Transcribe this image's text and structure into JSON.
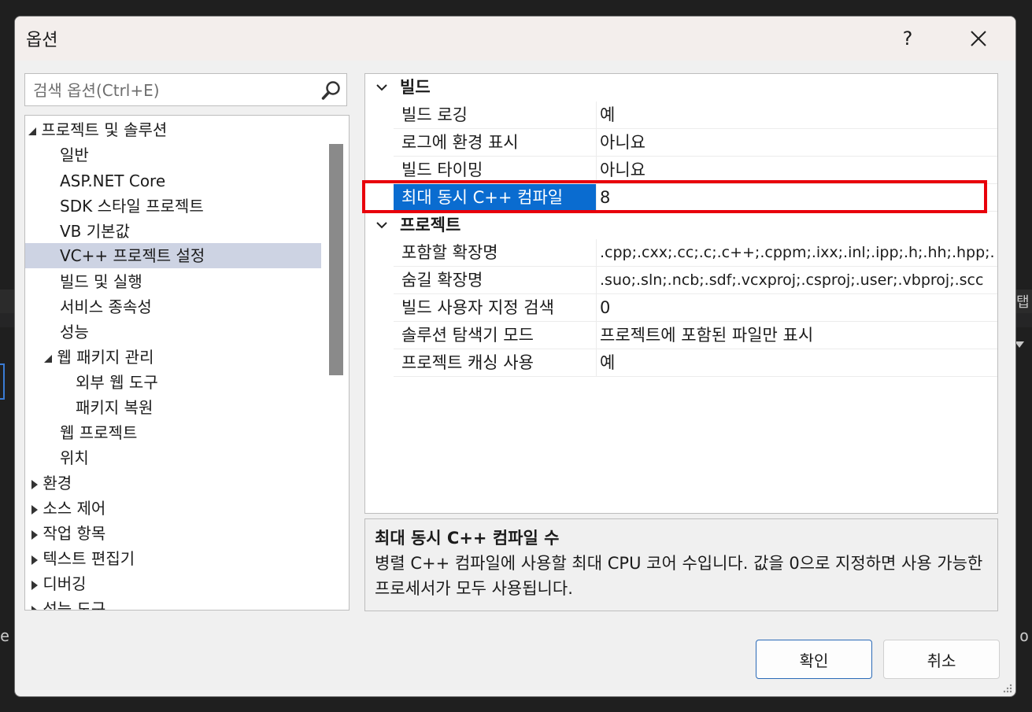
{
  "window": {
    "title": "옵션",
    "help_label": "?"
  },
  "search": {
    "placeholder": "검색 옵션(Ctrl+E)"
  },
  "tree": {
    "items": [
      {
        "label": "프로젝트 및 솔루션",
        "level": 0,
        "state": "expanded"
      },
      {
        "label": "일반",
        "level": 1
      },
      {
        "label": "ASP.NET Core",
        "level": 1
      },
      {
        "label": "SDK 스타일 프로젝트",
        "level": 1
      },
      {
        "label": "VB 기본값",
        "level": 1
      },
      {
        "label": "VC++ 프로젝트 설정",
        "level": 1,
        "selected": true
      },
      {
        "label": "빌드 및 실행",
        "level": 1
      },
      {
        "label": "서비스 종속성",
        "level": 1
      },
      {
        "label": "성능",
        "level": 1
      },
      {
        "label": "웹 패키지 관리",
        "level": 1,
        "state": "expanded"
      },
      {
        "label": "외부 웹 도구",
        "level": 2
      },
      {
        "label": "패키지 복원",
        "level": 2
      },
      {
        "label": "웹 프로젝트",
        "level": 1
      },
      {
        "label": "위치",
        "level": 1
      },
      {
        "label": "환경",
        "level": 0,
        "state": "collapsed"
      },
      {
        "label": "소스 제어",
        "level": 0,
        "state": "collapsed"
      },
      {
        "label": "작업 항목",
        "level": 0,
        "state": "collapsed"
      },
      {
        "label": "텍스트 편집기",
        "level": 0,
        "state": "collapsed"
      },
      {
        "label": "디버깅",
        "level": 0,
        "state": "collapsed"
      },
      {
        "label": "성능 도구",
        "level": 0,
        "state": "collapsed"
      }
    ]
  },
  "grid": {
    "categories": [
      {
        "label": "빌드",
        "rows": [
          {
            "name": "빌드 로깅",
            "value": "예"
          },
          {
            "name": "로그에 환경 표시",
            "value": "아니요"
          },
          {
            "name": "빌드 타이밍",
            "value": "아니요"
          },
          {
            "name": "최대 동시 C++ 컴파일",
            "value": "8",
            "selected": true
          }
        ]
      },
      {
        "label": "프로젝트",
        "rows": [
          {
            "name": "포함할 확장명",
            "value": ".cpp;.cxx;.cc;.c;.c++;.cppm;.ixx;.inl;.ipp;.h;.hh;.hpp;."
          },
          {
            "name": "숨길 확장명",
            "value": ".suo;.sln;.ncb;.sdf;.vcxproj;.csproj;.user;.vbproj;.scc"
          },
          {
            "name": "빌드 사용자 지정 검색",
            "value": "0"
          },
          {
            "name": "솔루션 탐색기 모드",
            "value": "프로젝트에 포함된 파일만 표시"
          },
          {
            "name": "프로젝트 캐싱 사용",
            "value": "예"
          }
        ]
      }
    ]
  },
  "description": {
    "title": "최대 동시 C++ 컴파일 수",
    "text": "병렬 C++ 컴파일에 사용할 최대 CPU 코어 수입니다. 값을 0으로 지정하면 사용 가능한 프로세서가 모두 사용됩니다."
  },
  "buttons": {
    "ok": "확인",
    "cancel": "취소"
  },
  "background": {
    "right_text": "탭",
    "right_char": "o",
    "left_char": "e"
  },
  "colors": {
    "accent": "#0a6cd0",
    "highlight": "#e8000b",
    "selected_tree": "#cdd3e3"
  }
}
